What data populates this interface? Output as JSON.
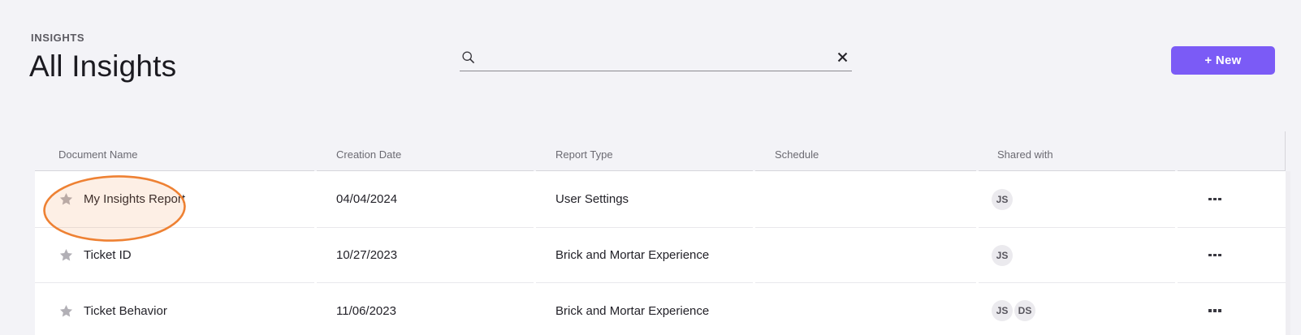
{
  "page": {
    "eyebrow": "INSIGHTS",
    "title": "All Insights"
  },
  "search": {
    "value": "",
    "placeholder": ""
  },
  "actions": {
    "new_button_label": "+ New"
  },
  "icons": {
    "search": "magnifier",
    "clear": "x-mark",
    "favorite": "star",
    "row_menu": "ellipsis"
  },
  "table": {
    "columns": {
      "document_name": "Document Name",
      "creation_date": "Creation Date",
      "report_type": "Report Type",
      "schedule": "Schedule",
      "shared_with": "Shared with"
    },
    "rows": [
      {
        "document_name": "My Insights Report",
        "creation_date": "04/04/2024",
        "report_type": "User Settings",
        "schedule": "",
        "shared_with": [
          "JS"
        ],
        "highlighted": true
      },
      {
        "document_name": "Ticket ID",
        "creation_date": "10/27/2023",
        "report_type": "Brick and Mortar Experience",
        "schedule": "",
        "shared_with": [
          "JS"
        ],
        "highlighted": false
      },
      {
        "document_name": "Ticket Behavior",
        "creation_date": "11/06/2023",
        "report_type": "Brick and Mortar Experience",
        "schedule": "",
        "shared_with": [
          "JS",
          "DS"
        ],
        "highlighted": false
      }
    ]
  },
  "annotation": {
    "type": "hand-drawn-ellipse-highlight",
    "target": "My Insights Report",
    "color": "#ee8133"
  },
  "colors": {
    "accent": "#7b5bf6",
    "page_bg": "#f3f3f7",
    "row_bg": "#ffffff",
    "annotation": "#ee8133",
    "avatar_bg": "#ebeaee"
  }
}
